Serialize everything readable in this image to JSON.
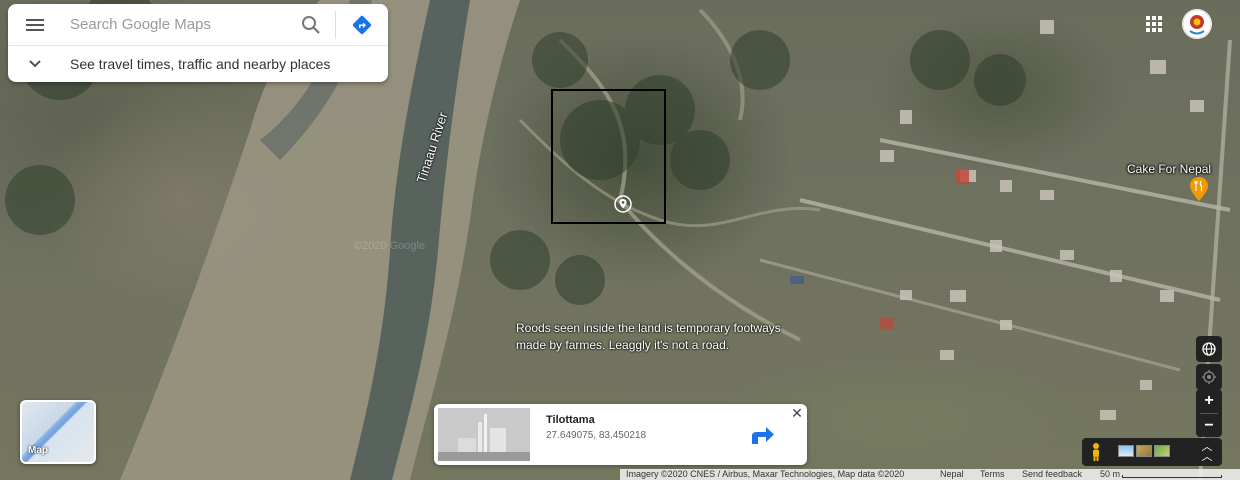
{
  "search": {
    "placeholder": "Search Google Maps",
    "travel_prompt": "See travel times, traffic and nearby places"
  },
  "map": {
    "river_label": "Tinaau River",
    "watermark": "©2020 Google",
    "place_label": "Cake For Nepal",
    "note_line1": "Roods seen inside the land is temporary footways",
    "note_line2": "made by farmes. Leaggly it's not a road."
  },
  "info_card": {
    "title": "Tilottama",
    "coords": "27.649075, 83.450218"
  },
  "layer_toggle": {
    "label": "Map"
  },
  "attribution": {
    "imagery": "Imagery ©2020 CNES / Airbus, Maxar Technologies, Map data ©2020",
    "country": "Nepal",
    "terms": "Terms",
    "feedback": "Send feedback",
    "scale": "50 m"
  },
  "colors": {
    "accent_blue": "#1a73e8",
    "food_pin": "#f29900",
    "ctrl_dark": "#222222"
  },
  "icons": {
    "menu": "hamburger-icon",
    "search": "search-icon",
    "directions": "directions-icon",
    "expand": "chevron-down-icon",
    "apps": "apps-grid-icon",
    "avatar": "avatar",
    "food": "restaurant-pin-icon",
    "location": "location-pin-icon",
    "globe": "globe-icon",
    "my_location": "my-location-icon",
    "pegman": "pegman-icon",
    "close": "close-icon"
  }
}
